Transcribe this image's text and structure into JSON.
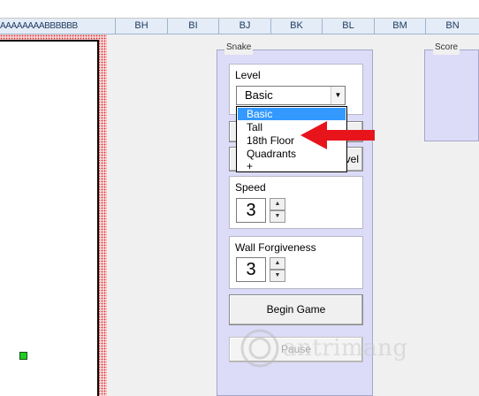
{
  "header": {
    "narrow_cols": "AAAAAAAABBBBBB",
    "columns": [
      "BH",
      "BI",
      "BJ",
      "BK",
      "BL",
      "BM",
      "BN"
    ]
  },
  "panel": {
    "title": "Snake",
    "level": {
      "label": "Level",
      "selected": "Basic",
      "options": [
        "Basic",
        "Tall",
        "18th Floor",
        "Quadrants",
        "+"
      ]
    },
    "hidden_button_fragment": "vel",
    "speed": {
      "label": "Speed",
      "value": "3"
    },
    "wall": {
      "label": "Wall Forgiveness",
      "value": "3"
    },
    "begin_label": "Begin Game",
    "pause_label": "Pause"
  },
  "score": {
    "title": "Score"
  },
  "watermark": {
    "text": "antrimang"
  },
  "colors": {
    "selection": "#3399ff",
    "panel_bg": "#dcdcf8",
    "arrow": "#e8141c",
    "food": "#22cc22"
  }
}
